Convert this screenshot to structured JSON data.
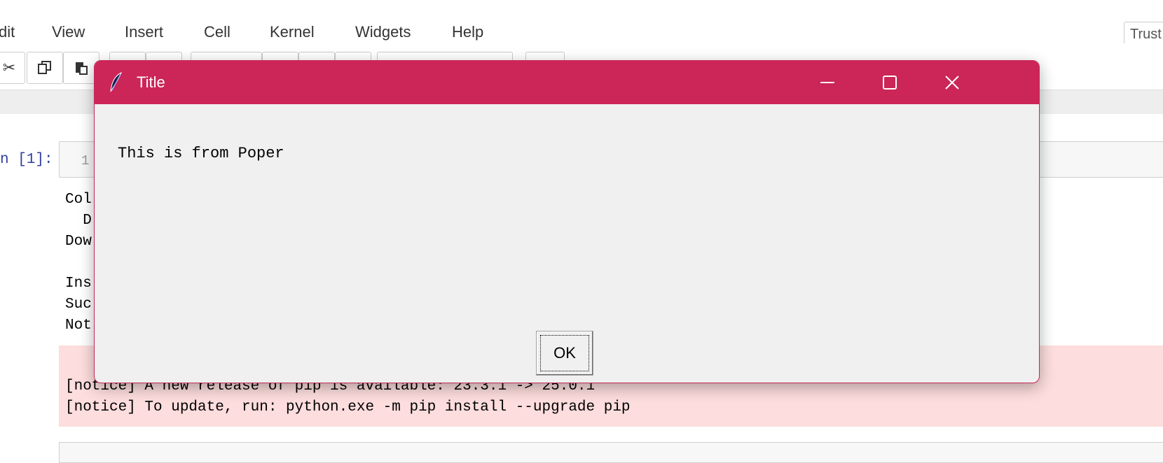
{
  "menubar": {
    "items": [
      "dit",
      "View",
      "Insert",
      "Cell",
      "Kernel",
      "Widgets",
      "Help"
    ],
    "trusted": "Trust"
  },
  "notebook": {
    "prompt": "n [1]:",
    "input_line_number": "1",
    "output_lines": [
      "Col",
      "  D",
      "Dow",
      "",
      "Ins",
      "Suc",
      "Not"
    ],
    "stderr_lines": [
      "[notice] A new release of pip is available: 23.3.1 -> 25.0.1",
      "[notice] To update, run: python.exe -m pip install --upgrade pip"
    ]
  },
  "dialog": {
    "title": "Title",
    "message": "This is from Poper",
    "ok_label": "OK",
    "titlebar_color": "#cc2557",
    "icons": {
      "app": "feather-icon",
      "minimize": "minimize-icon",
      "maximize": "maximize-icon",
      "close": "close-icon"
    }
  }
}
